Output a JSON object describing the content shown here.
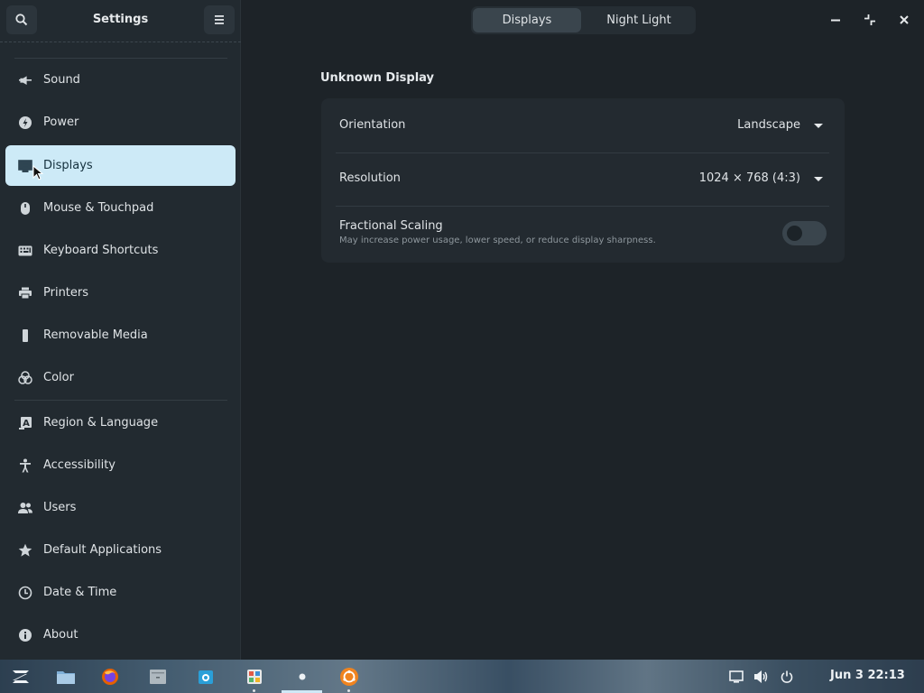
{
  "app": {
    "title": "Settings"
  },
  "sidebar": {
    "items": [
      {
        "label": "Sound",
        "icon": "speaker-icon"
      },
      {
        "label": "Power",
        "icon": "power-icon"
      },
      {
        "label": "Displays",
        "icon": "display-icon",
        "active": true
      },
      {
        "label": "Mouse & Touchpad",
        "icon": "mouse-icon"
      },
      {
        "label": "Keyboard Shortcuts",
        "icon": "keyboard-icon"
      },
      {
        "label": "Printers",
        "icon": "printer-icon"
      },
      {
        "label": "Removable Media",
        "icon": "usb-drive-icon"
      },
      {
        "label": "Color",
        "icon": "color-icon"
      },
      {
        "label": "Region & Language",
        "icon": "language-icon"
      },
      {
        "label": "Accessibility",
        "icon": "accessibility-icon"
      },
      {
        "label": "Users",
        "icon": "users-icon"
      },
      {
        "label": "Default Applications",
        "icon": "star-icon"
      },
      {
        "label": "Date & Time",
        "icon": "clock-icon"
      },
      {
        "label": "About",
        "icon": "info-icon"
      }
    ]
  },
  "header": {
    "tabs": [
      {
        "label": "Displays",
        "active": true
      },
      {
        "label": "Night Light",
        "active": false
      }
    ]
  },
  "main": {
    "section_title": "Unknown Display",
    "orientation": {
      "label": "Orientation",
      "value": "Landscape"
    },
    "resolution": {
      "label": "Resolution",
      "value": "1024 × 768 (4:3)"
    },
    "fractional_scaling": {
      "label": "Fractional Scaling",
      "description": "May increase power usage, lower speed, or reduce display sharpness.",
      "enabled": false
    }
  },
  "taskbar": {
    "date": "Jun 3",
    "time": "22:13",
    "clock": "Jun 3  22:13"
  },
  "colors": {
    "accent": "#cdeaf7",
    "background": "#1d2328",
    "sidebar": "#222a30"
  }
}
